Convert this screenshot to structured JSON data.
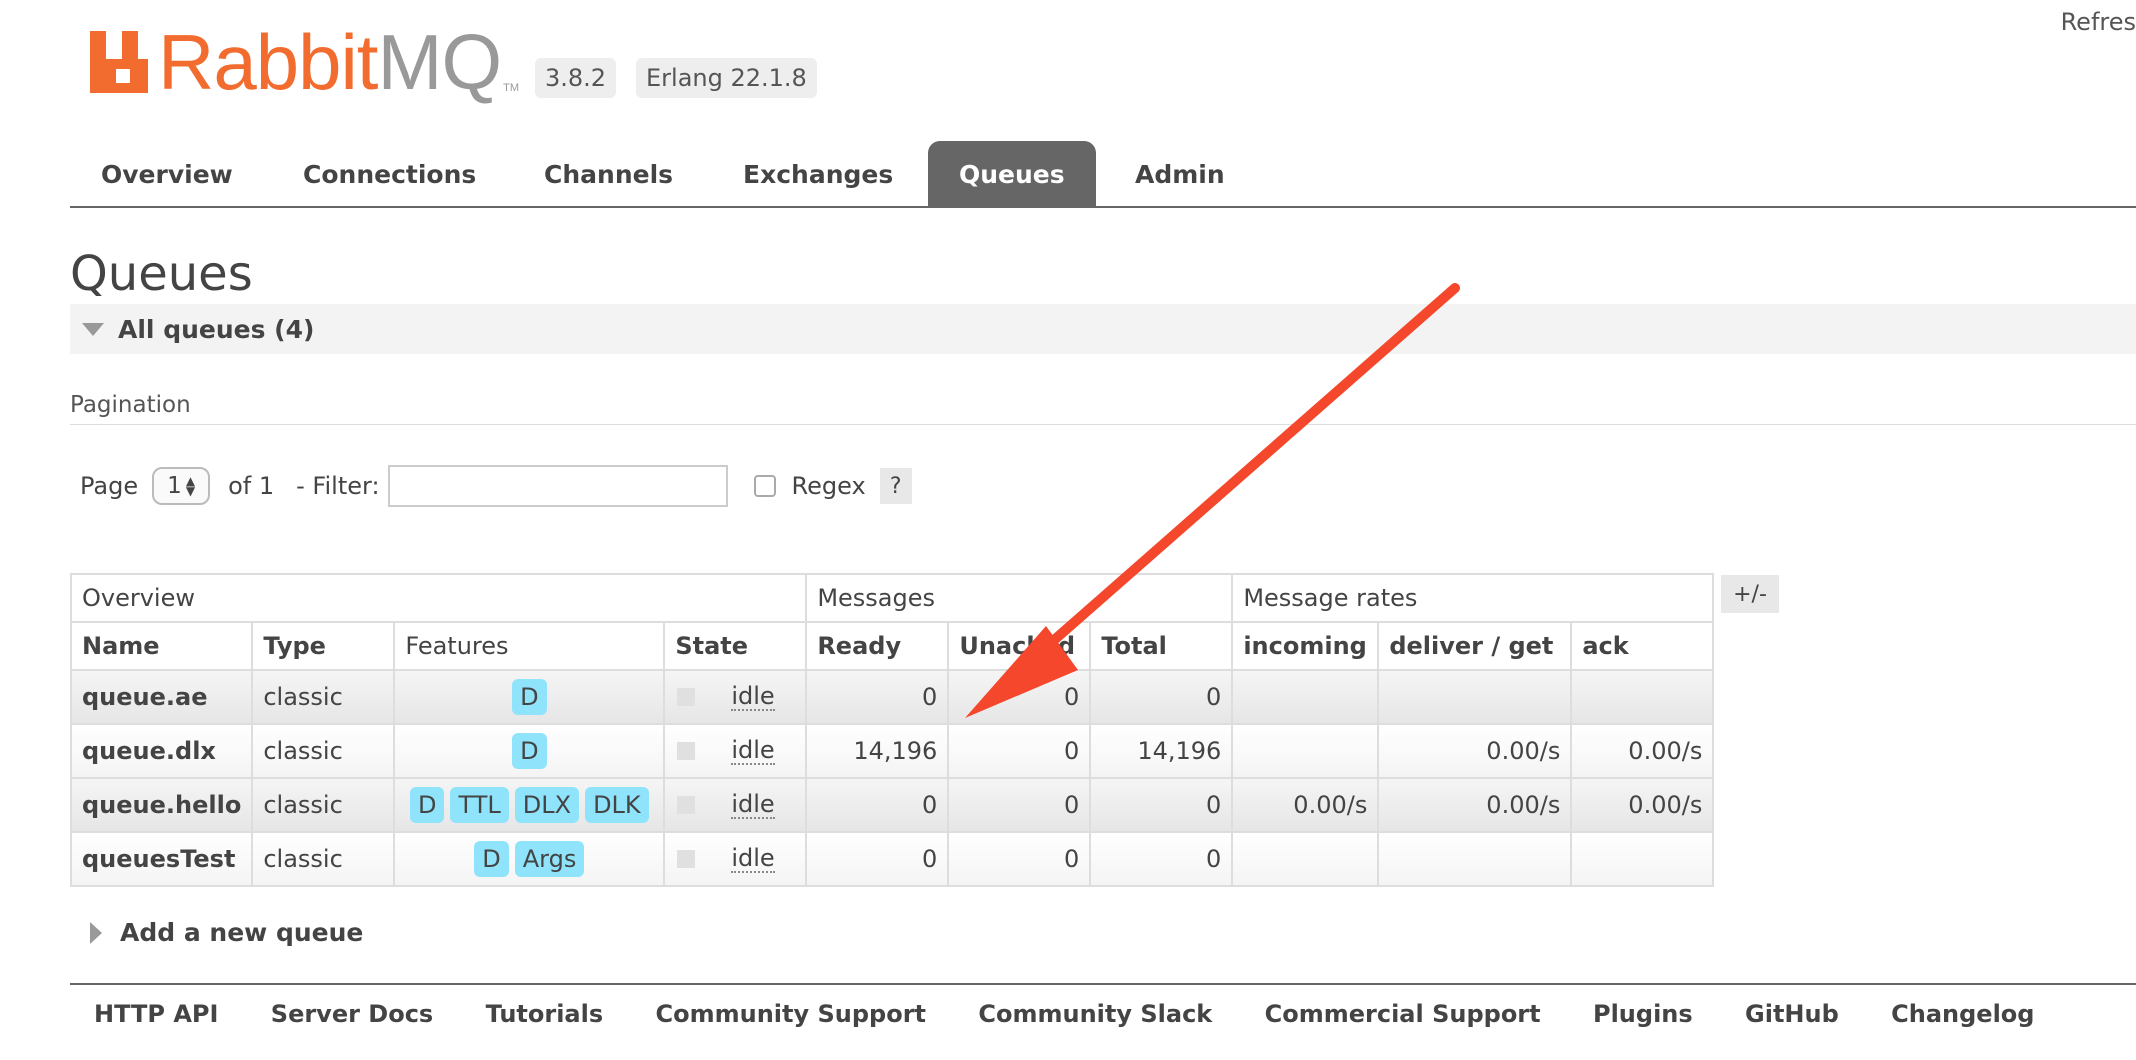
{
  "header": {
    "logo_text_a": "Rabbit",
    "logo_text_b": "MQ",
    "logo_tm": "TM",
    "version": "3.8.2",
    "erlang": "Erlang 22.1.8",
    "refresh": "Refres"
  },
  "tabs": [
    {
      "label": "Overview",
      "active": false
    },
    {
      "label": "Connections",
      "active": false
    },
    {
      "label": "Channels",
      "active": false
    },
    {
      "label": "Exchanges",
      "active": false
    },
    {
      "label": "Queues",
      "active": true
    },
    {
      "label": "Admin",
      "active": false
    }
  ],
  "page": {
    "title": "Queues",
    "section": "All queues (4)"
  },
  "pagination": {
    "label": "Pagination",
    "page_label": "Page",
    "page_value": "1",
    "of_label": "of 1",
    "filter_label": "- Filter:",
    "filter_value": "",
    "regex_label": "Regex",
    "help": "?"
  },
  "table": {
    "groups": [
      "Overview",
      "Messages",
      "Message rates"
    ],
    "columns": [
      "Name",
      "Type",
      "Features",
      "State",
      "Ready",
      "Unacked",
      "Total",
      "incoming",
      "deliver / get",
      "ack"
    ],
    "rows": [
      {
        "name": "queue.ae",
        "type": "classic",
        "features": [
          "D"
        ],
        "state": "idle",
        "ready": "0",
        "unacked": "0",
        "total": "0",
        "incoming": "",
        "deliver": "",
        "ack": ""
      },
      {
        "name": "queue.dlx",
        "type": "classic",
        "features": [
          "D"
        ],
        "state": "idle",
        "ready": "14,196",
        "unacked": "0",
        "total": "14,196",
        "incoming": "",
        "deliver": "0.00/s",
        "ack": "0.00/s"
      },
      {
        "name": "queue.hello",
        "type": "classic",
        "features": [
          "D",
          "TTL",
          "DLX",
          "DLK"
        ],
        "state": "idle",
        "ready": "0",
        "unacked": "0",
        "total": "0",
        "incoming": "0.00/s",
        "deliver": "0.00/s",
        "ack": "0.00/s"
      },
      {
        "name": "queuesTest",
        "type": "classic",
        "features": [
          "D",
          "Args"
        ],
        "state": "idle",
        "ready": "0",
        "unacked": "0",
        "total": "0",
        "incoming": "",
        "deliver": "",
        "ack": ""
      }
    ],
    "plusminus": "+/-"
  },
  "add_queue": "Add a new queue",
  "footer": [
    "HTTP API",
    "Server Docs",
    "Tutorials",
    "Community Support",
    "Community Slack",
    "Commercial Support",
    "Plugins",
    "GitHub",
    "Changelog"
  ],
  "colors": {
    "brand": "#f26c2f",
    "active_tab": "#666666",
    "feature_tag": "#8fe4fc",
    "annotation_arrow": "#f4472b"
  }
}
